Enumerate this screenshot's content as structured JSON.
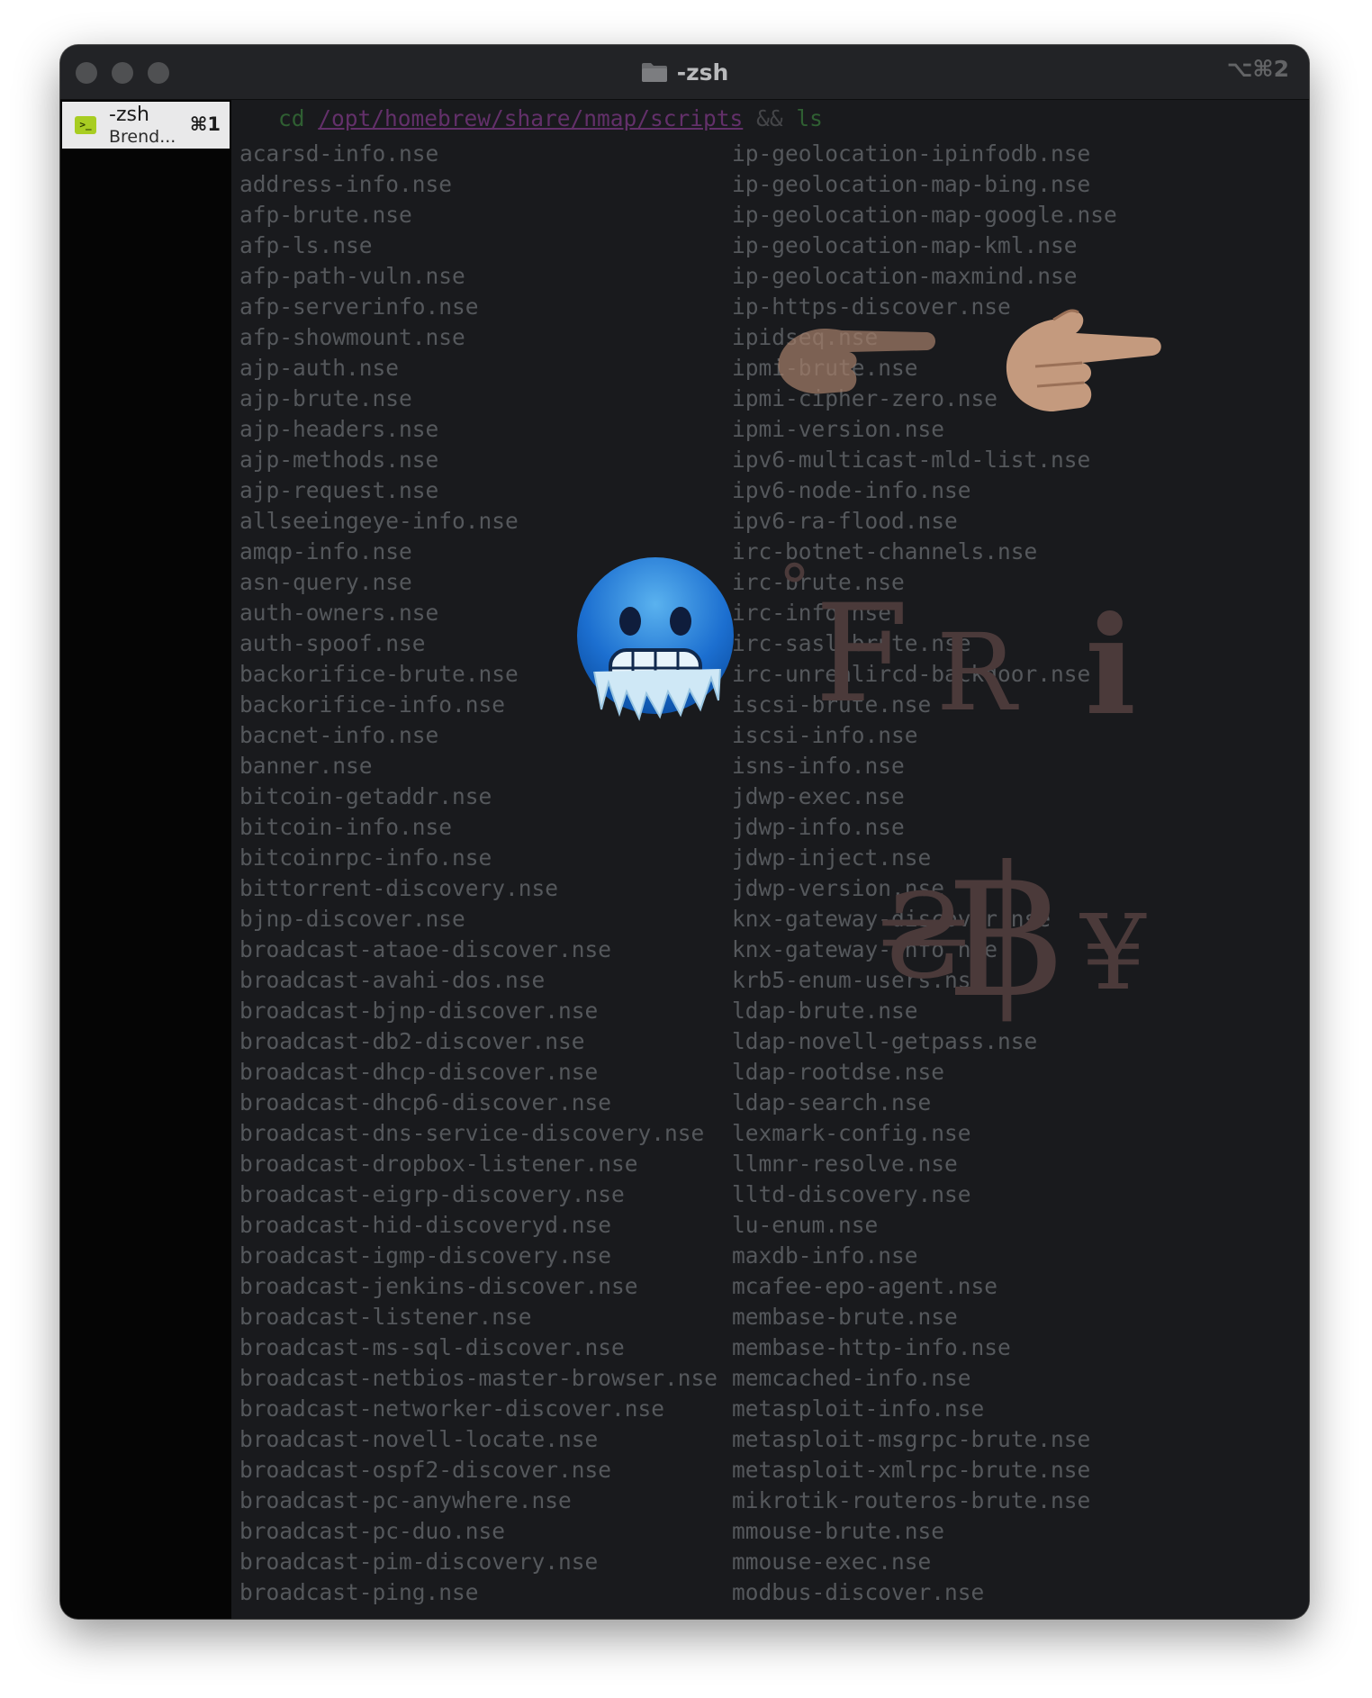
{
  "window": {
    "title": "-zsh",
    "shortcut": "⌥⌘2"
  },
  "sidebar": {
    "tab": {
      "title": "-zsh",
      "subtitle": "Brend...",
      "shortcut": "⌘1",
      "icon_glyph": ">_"
    }
  },
  "terminal": {
    "command": {
      "cd": "cd",
      "path": "/opt/homebrew/share/nmap/scripts",
      "op": "&&",
      "ls": "ls"
    },
    "left_column": [
      "acarsd-info.nse",
      "address-info.nse",
      "afp-brute.nse",
      "afp-ls.nse",
      "afp-path-vuln.nse",
      "afp-serverinfo.nse",
      "afp-showmount.nse",
      "ajp-auth.nse",
      "ajp-brute.nse",
      "ajp-headers.nse",
      "ajp-methods.nse",
      "ajp-request.nse",
      "allseeingeye-info.nse",
      "amqp-info.nse",
      "asn-query.nse",
      "auth-owners.nse",
      "auth-spoof.nse",
      "backorifice-brute.nse",
      "backorifice-info.nse",
      "bacnet-info.nse",
      "banner.nse",
      "bitcoin-getaddr.nse",
      "bitcoin-info.nse",
      "bitcoinrpc-info.nse",
      "bittorrent-discovery.nse",
      "bjnp-discover.nse",
      "broadcast-ataoe-discover.nse",
      "broadcast-avahi-dos.nse",
      "broadcast-bjnp-discover.nse",
      "broadcast-db2-discover.nse",
      "broadcast-dhcp-discover.nse",
      "broadcast-dhcp6-discover.nse",
      "broadcast-dns-service-discovery.nse",
      "broadcast-dropbox-listener.nse",
      "broadcast-eigrp-discovery.nse",
      "broadcast-hid-discoveryd.nse",
      "broadcast-igmp-discovery.nse",
      "broadcast-jenkins-discover.nse",
      "broadcast-listener.nse",
      "broadcast-ms-sql-discover.nse",
      "broadcast-netbios-master-browser.nse",
      "broadcast-networker-discover.nse",
      "broadcast-novell-locate.nse",
      "broadcast-ospf2-discover.nse",
      "broadcast-pc-anywhere.nse",
      "broadcast-pc-duo.nse",
      "broadcast-pim-discovery.nse",
      "broadcast-ping.nse"
    ],
    "right_column": [
      "ip-geolocation-ipinfodb.nse",
      "ip-geolocation-map-bing.nse",
      "ip-geolocation-map-google.nse",
      "ip-geolocation-map-kml.nse",
      "ip-geolocation-maxmind.nse",
      "ip-https-discover.nse",
      "ipidseq.nse",
      "ipmi-brute.nse",
      "ipmi-cipher-zero.nse",
      "ipmi-version.nse",
      "ipv6-multicast-mld-list.nse",
      "ipv6-node-info.nse",
      "ipv6-ra-flood.nse",
      "irc-botnet-channels.nse",
      "irc-brute.nse",
      "irc-info.nse",
      "irc-sasl-brute.nse",
      "irc-unrealircd-backdoor.nse",
      "iscsi-brute.nse",
      "iscsi-info.nse",
      "isns-info.nse",
      "jdwp-exec.nse",
      "jdwp-info.nse",
      "jdwp-inject.nse",
      "jdwp-version.nse",
      "knx-gateway-discover.nse",
      "knx-gateway-info.nse",
      "krb5-enum-users.nse",
      "ldap-brute.nse",
      "ldap-novell-getpass.nse",
      "ldap-rootdse.nse",
      "ldap-search.nse",
      "lexmark-config.nse",
      "llmnr-resolve.nse",
      "lltd-discovery.nse",
      "lu-enum.nse",
      "maxdb-info.nse",
      "mcafee-epo-agent.nse",
      "membase-brute.nse",
      "membase-http-info.nse",
      "memcached-info.nse",
      "metasploit-info.nse",
      "metasploit-msgrpc-brute.nse",
      "metasploit-xmlrpc-brute.nse",
      "mikrotik-routeros-brute.nse",
      "mmouse-brute.nse",
      "mmouse-exec.nse",
      "modbus-discover.nse"
    ]
  },
  "overlays": {
    "weather": {
      "degree": "°",
      "letters": [
        "F",
        "R",
        "i"
      ]
    },
    "currency": [
      "₴",
      "฿",
      "¥"
    ]
  },
  "colors": {
    "window_bg": "#16171a",
    "terminal_bg": "#191a1d",
    "text_dim": "#55585c",
    "prompt_green": "#2f5f32",
    "path_purple": "#63306a",
    "tab_icon_green": "#a8cd22",
    "overlay_brown": "#4b3a3a"
  }
}
